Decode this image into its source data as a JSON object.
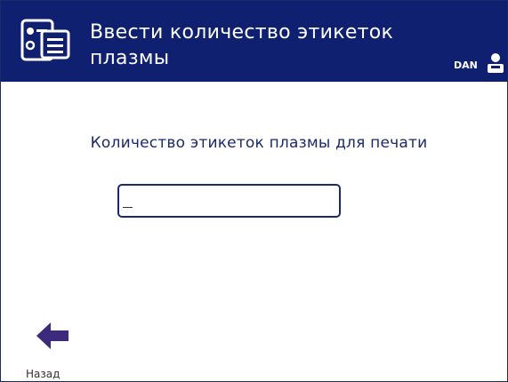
{
  "header": {
    "title_line1": "Ввести количество этикеток",
    "title_line2": "плазмы",
    "user": "DAN",
    "app_icon": "label-printer-icon",
    "user_icon": "user-icon",
    "background_color": "#0f2070"
  },
  "form": {
    "prompt": "Количество этикеток плазмы для печати",
    "quantity_value": ""
  },
  "footer": {
    "back_label": "Назад",
    "back_icon": "arrow-left-icon",
    "back_icon_color": "#3c2a7d"
  }
}
